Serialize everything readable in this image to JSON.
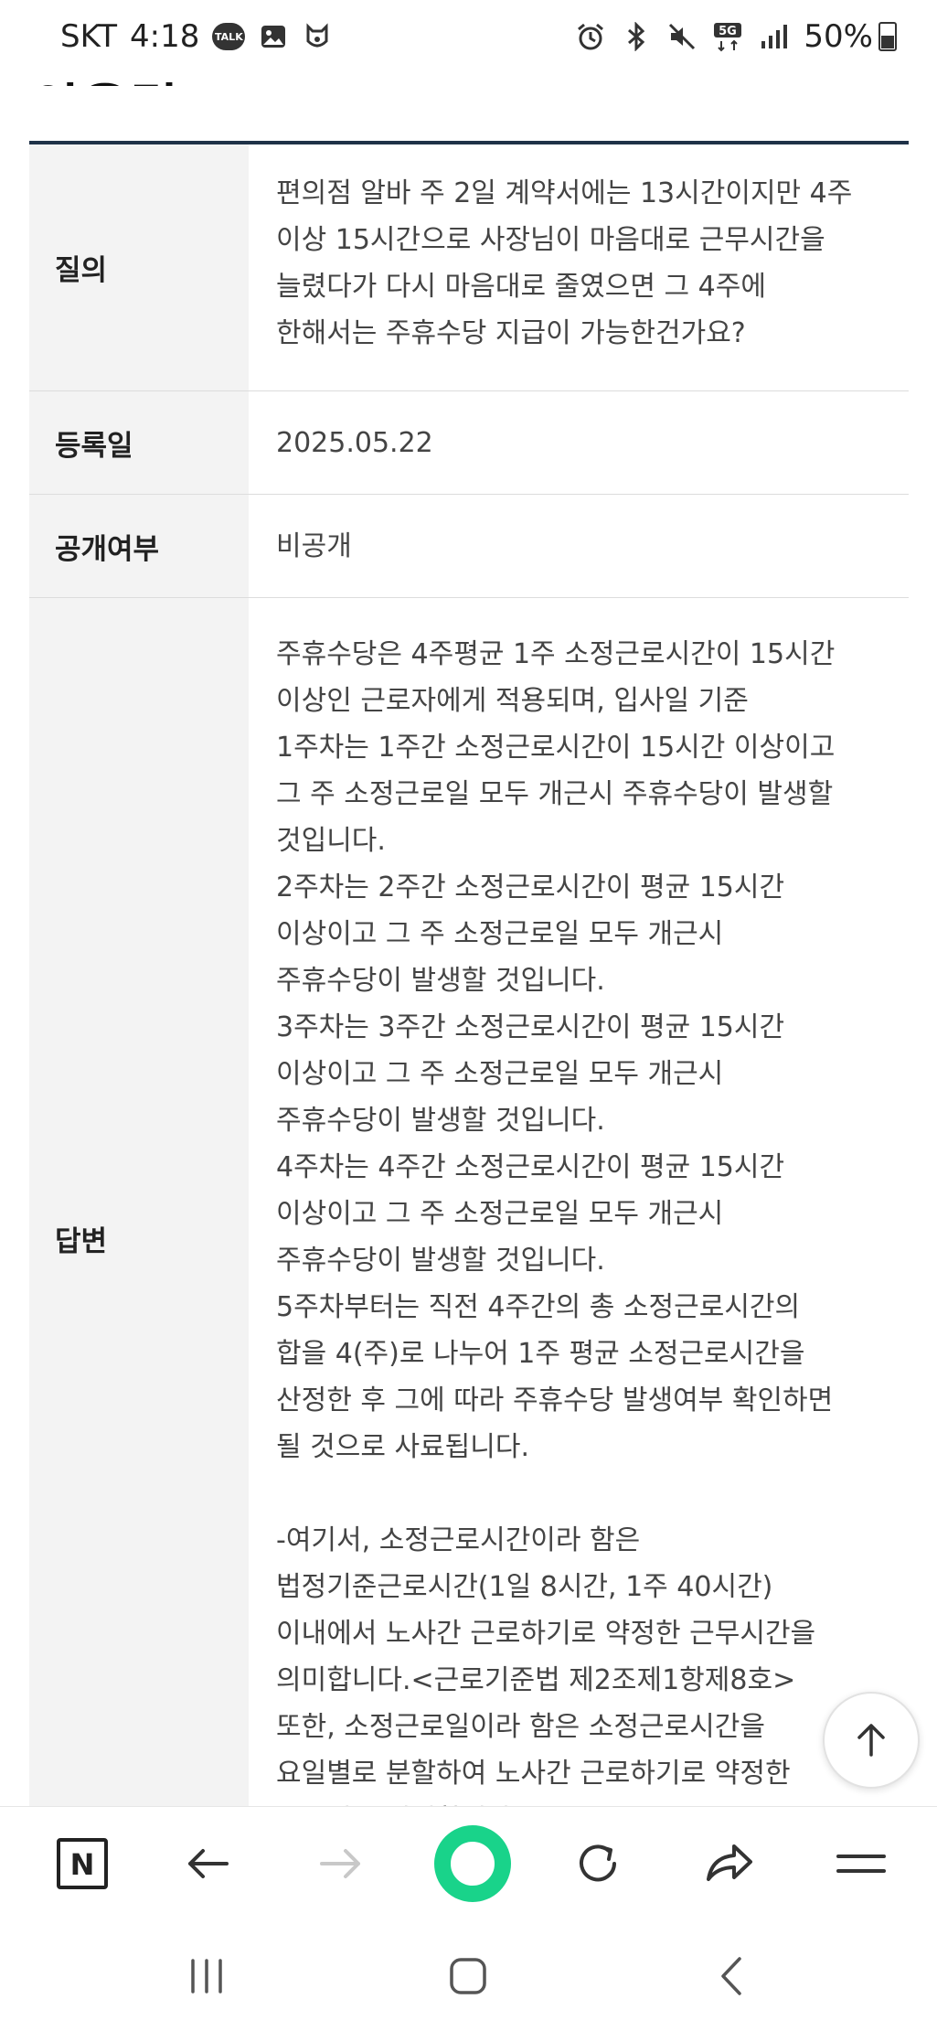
{
  "status_bar": {
    "carrier": "SKT",
    "time": "4:18",
    "talk_badge": "TALK",
    "network": "5G",
    "battery": "50%",
    "battery_level": 0.5
  },
  "page_title": "국민신문고 질의응답",
  "table": {
    "question": {
      "label": "질의",
      "lines": [
        "편의점 알바 주 2일 계약서에는 13시간이지만 4주",
        "이상 15시간으로 사장님이 마음대로 근무시간을",
        "늘렸다가 다시 마음대로 줄였으면 그 4주에",
        "한해서는 주휴수당 지급이 가능한건가요?"
      ]
    },
    "reg_date": {
      "label": "등록일",
      "value": "2025.05.22"
    },
    "public": {
      "label": "공개여부",
      "value": "비공개"
    },
    "answer": {
      "label": "답변",
      "lines": [
        "주휴수당은 4주평균 1주 소정근로시간이 15시간",
        "이상인 근로자에게 적용되며, 입사일 기준",
        "1주차는 1주간 소정근로시간이 15시간 이상이고",
        "그 주 소정근로일 모두 개근시 주휴수당이 발생할",
        "것입니다.",
        "2주차는 2주간 소정근로시간이 평균 15시간",
        "이상이고 그 주 소정근로일 모두 개근시",
        "주휴수당이 발생할 것입니다.",
        "3주차는 3주간 소정근로시간이 평균 15시간",
        "이상이고 그 주 소정근로일 모두 개근시",
        "주휴수당이 발생할 것입니다.",
        "4주차는 4주간 소정근로시간이 평균 15시간",
        "이상이고 그 주 소정근로일 모두 개근시",
        "주휴수당이 발생할 것입니다.",
        "5주차부터는 직전 4주간의 총 소정근로시간의",
        "합을 4(주)로 나누어 1주 평균 소정근로시간을",
        "산정한 후 그에 따라 주휴수당 발생여부 확인하면",
        "될 것으로 사료됩니다.",
        "",
        "-여기서, 소정근로시간이라 함은",
        "법정기준근로시간(1일 8시간, 1주 40시간)",
        "이내에서 노사간 근로하기로 약정한 근무시간을",
        "의미합니다.<근로기준법 제2조제1항제8호>",
        "또한, 소정근로일이라 함은 소정근로시간을",
        "요일별로 분할하여 노사간 근로하기로 약정한",
        "근무일을 의미합니다."
      ]
    }
  },
  "browser_toolbar": {
    "home_letter": "N",
    "accent_color": "#19d38a"
  }
}
